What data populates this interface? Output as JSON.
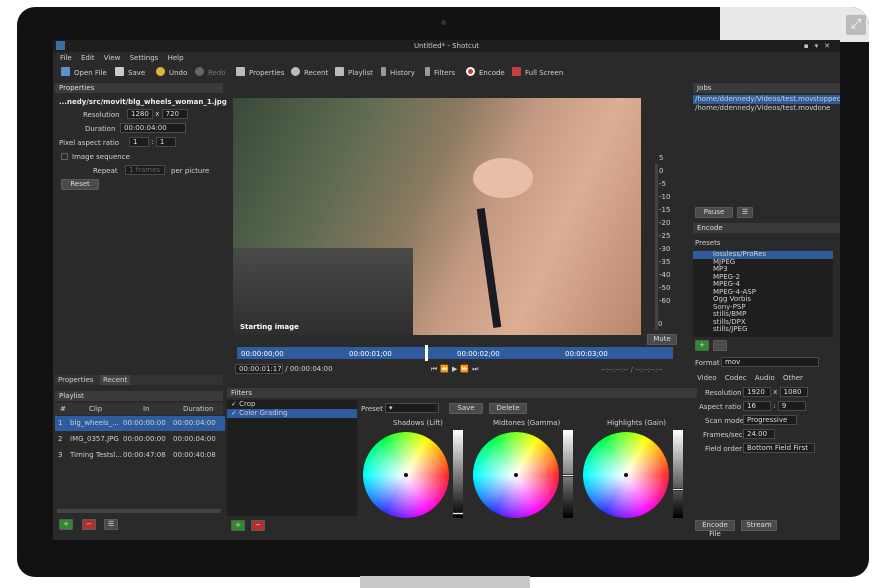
{
  "window": {
    "title": "Untitled* - Shotcut"
  },
  "menu": [
    "File",
    "Edit",
    "View",
    "Settings",
    "Help"
  ],
  "toolbar": {
    "open": "Open File",
    "save": "Save",
    "undo": "Undo",
    "redo": "Redo",
    "properties": "Properties",
    "recent": "Recent",
    "playlist": "Playlist",
    "history": "History",
    "filters": "Filters",
    "encode": "Encode",
    "fullscreen": "Full Screen"
  },
  "properties": {
    "header": "Properties",
    "filename": "...nedy/src/movit/blg_wheels_woman_1.jpg",
    "resolution_label": "Resolution",
    "res_w": "1280",
    "res_x": "x",
    "res_h": "720",
    "duration_label": "Duration",
    "duration": "00:00:04:00",
    "par_label": "Pixel aspect ratio",
    "par_a": "1",
    "par_sep": ":",
    "par_b": "1",
    "image_seq": "Image sequence",
    "repeat_label": "Repeat",
    "repeat_value": "1 frames",
    "per_picture": "per picture",
    "reset": "Reset",
    "tab_properties": "Properties",
    "tab_recent": "Recent"
  },
  "playlist": {
    "header": "Playlist",
    "columns": [
      "#",
      "Clip",
      "In",
      "Duration"
    ],
    "rows": [
      {
        "n": "1",
        "clip": "blg_wheels_...",
        "in": "00:00:00:00",
        "dur": "00:00:04:00"
      },
      {
        "n": "2",
        "clip": "IMG_0357.JPG",
        "in": "00:00:00:00",
        "dur": "00:00:04:00"
      },
      {
        "n": "3",
        "clip": "Timing Testsl...",
        "in": "00:00:47:08",
        "dur": "00:00:40:08"
      }
    ],
    "add": "+",
    "remove": "−",
    "menu": "☰"
  },
  "viewer": {
    "overlay": "Starting image",
    "meter": [
      "5",
      "0",
      "-5",
      "-10",
      "-15",
      "-20",
      "-25",
      "-30",
      "-35",
      "-40",
      "-50",
      "-60"
    ],
    "meter_zero": "0",
    "mute": "Mute",
    "ruler": [
      "00:00:00;00",
      "00:00:01;00",
      "00:00:02;00",
      "00:00:03;00"
    ],
    "position": "00:00:01:17",
    "total": "/ 00:00:04:00",
    "inout": "--:--:--:-- / --:--:--:--"
  },
  "filters": {
    "header": "Filters",
    "items": [
      {
        "label": "Crop",
        "checked": "✓"
      },
      {
        "label": "Color Grading",
        "checked": "✓"
      }
    ],
    "preset_label": "Preset",
    "save": "Save",
    "delete": "Delete",
    "shadows": "Shadows (Lift)",
    "midtones": "Midtones (Gamma)",
    "highlights": "Highlights (Gain)",
    "add": "+",
    "remove": "−"
  },
  "jobs": {
    "header": "Jobs",
    "items": [
      {
        "path": "/home/ddennedy/Videos/test.mov",
        "status": "stopped"
      },
      {
        "path": "/home/ddennedy/Videos/test.mov",
        "status": "done"
      }
    ],
    "pause": "Pause",
    "menu": "☰"
  },
  "encode": {
    "header": "Encode",
    "presets_label": "Presets",
    "presets": [
      "lossless/ProRes",
      "MJPEG",
      "MP3",
      "MPEG-2",
      "MPEG-4",
      "MPEG-4-ASP",
      "Ogg Vorbis",
      "Sony-PSP",
      "stills/BMP",
      "stills/DPX",
      "stills/JPEG"
    ],
    "add": "+",
    "remove": "−",
    "format_label": "Format",
    "format": "mov",
    "tabs": [
      "Video",
      "Codec",
      "Audio",
      "Other"
    ],
    "resolution_label": "Resolution",
    "res_w": "1920",
    "res_x": "x",
    "res_h": "1080",
    "aspect_label": "Aspect ratio",
    "aspect_w": "16",
    "aspect_sep": ":",
    "aspect_h": "9",
    "scan_label": "Scan mode",
    "scan": "Progressive",
    "fps_label": "Frames/sec",
    "fps": "24.00",
    "field_label": "Field order",
    "field": "Bottom Field First",
    "encode_file": "Encode File",
    "stream": "Stream"
  },
  "colors": {
    "accent": "#2f5c9e",
    "background": "#2a2a2a"
  }
}
